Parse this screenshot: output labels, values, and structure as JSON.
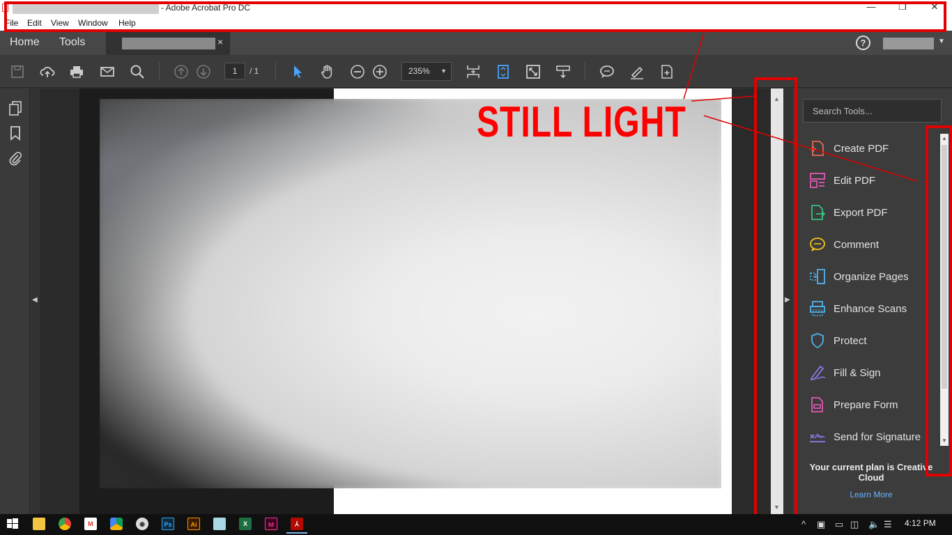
{
  "window": {
    "title": "- Adobe Acrobat Pro DC",
    "minimize": "—",
    "maximize": "❐",
    "close": "✕"
  },
  "menu": [
    "File",
    "Edit",
    "View",
    "Window",
    "Help"
  ],
  "tabs": {
    "home": "Home",
    "tools": "Tools",
    "doc_close": "×"
  },
  "toolbar": {
    "page_current": "1",
    "page_total": "/ 1",
    "zoom": "235%",
    "icons": [
      "save-icon",
      "cloud-upload-icon",
      "print-icon",
      "email-icon",
      "search-icon",
      "page-up-icon",
      "page-down-icon",
      "select-arrow-icon",
      "hand-icon",
      "zoom-out-icon",
      "zoom-in-icon",
      "fit-page-icon",
      "scroll-mode-icon",
      "full-screen-icon",
      "read-mode-icon",
      "comment-icon",
      "highlight-icon",
      "add-page-icon"
    ]
  },
  "annotation": {
    "text": "STILL LIGHT",
    "color": "#ff0000"
  },
  "right_panel": {
    "search_placeholder": "Search Tools...",
    "tools": [
      {
        "label": "Create PDF",
        "icon": "create-pdf-icon",
        "color": "#e8684f"
      },
      {
        "label": "Edit PDF",
        "icon": "edit-pdf-icon",
        "color": "#e058b4"
      },
      {
        "label": "Export PDF",
        "icon": "export-pdf-icon",
        "color": "#33c17c"
      },
      {
        "label": "Comment",
        "icon": "comment-icon",
        "color": "#f5c518"
      },
      {
        "label": "Organize Pages",
        "icon": "organize-pages-icon",
        "color": "#4fb3ec"
      },
      {
        "label": "Enhance Scans",
        "icon": "enhance-scans-icon",
        "color": "#4fb3ec"
      },
      {
        "label": "Protect",
        "icon": "protect-icon",
        "color": "#4fb3ec"
      },
      {
        "label": "Fill & Sign",
        "icon": "fill-sign-icon",
        "color": "#8b7be8"
      },
      {
        "label": "Prepare Form",
        "icon": "prepare-form-icon",
        "color": "#e058b4"
      },
      {
        "label": "Send for Signature",
        "icon": "send-signature-icon",
        "color": "#8b7be8"
      }
    ],
    "plan_text": "Your current plan is Creative Cloud",
    "learn_more": "Learn More"
  },
  "taskbar": {
    "apps": [
      "start-icon",
      "file-explorer-icon",
      "chrome-icon",
      "gmail-icon",
      "google-drive-icon",
      "vpn-icon",
      "photoshop-icon",
      "illustrator-icon",
      "notes-icon",
      "excel-icon",
      "indesign-icon",
      "acrobat-icon"
    ],
    "app_labels": {
      "photoshop": "Ps",
      "illustrator": "Ai",
      "excel": "X",
      "indesign": "Id"
    },
    "time": "4:12 PM"
  }
}
